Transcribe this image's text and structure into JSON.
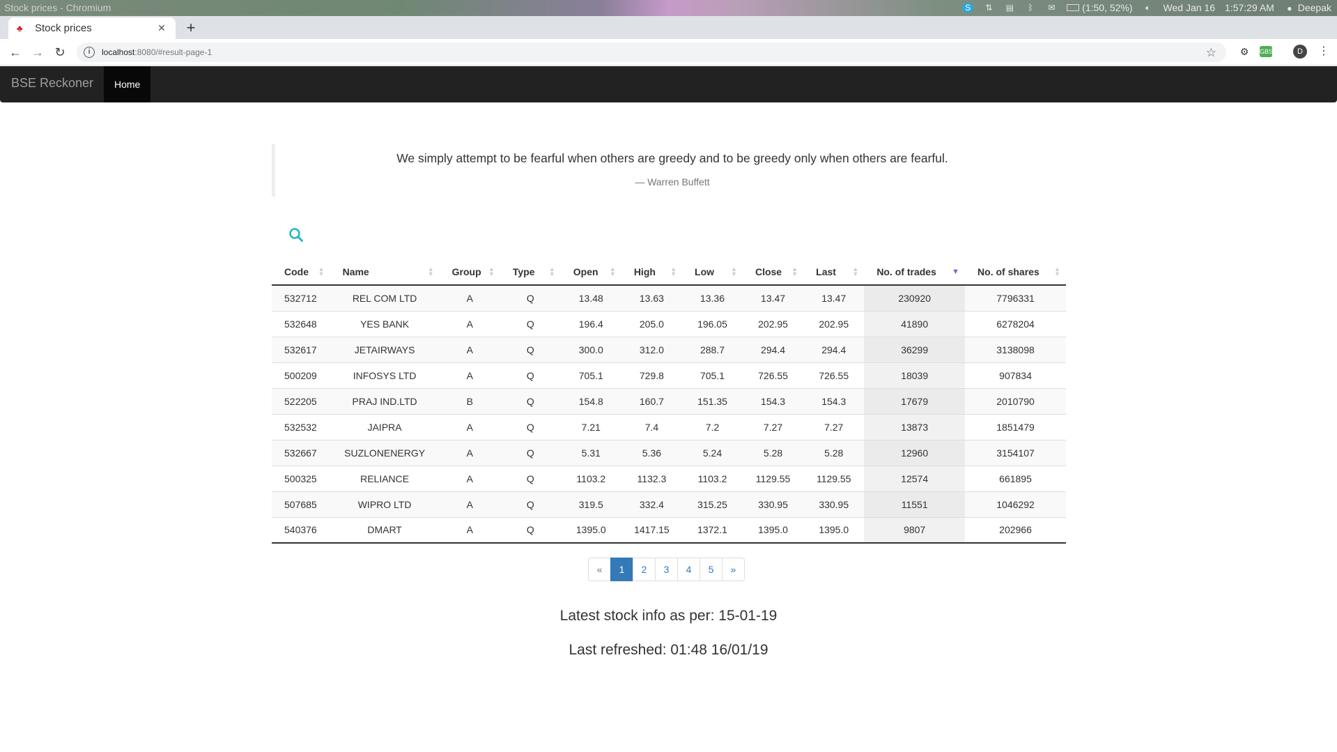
{
  "os": {
    "window_title": "Stock prices - Chromium",
    "battery": "(1:50, 52%)",
    "date": "Wed Jan 16",
    "time": "1:57:29 AM",
    "user": "Deepak"
  },
  "browser": {
    "tab_title": "Stock prices",
    "url_host": "localhost",
    "url_rest": ":8080/#result-page-1",
    "avatar_letter": "D",
    "ext_label": "GBS"
  },
  "navbar": {
    "brand": "BSE Reckoner",
    "home": "Home"
  },
  "quote": {
    "text": "We simply attempt to be fearful when others are greedy and to be greedy only when others are fearful.",
    "author": "— Warren Buffett"
  },
  "table": {
    "headers": [
      "Code",
      "Name",
      "Group",
      "Type",
      "Open",
      "High",
      "Low",
      "Close",
      "Last",
      "No. of trades",
      "No. of shares"
    ],
    "sorted_column": "No. of trades",
    "rows": [
      [
        "532712",
        "REL COM LTD",
        "A",
        "Q",
        "13.48",
        "13.63",
        "13.36",
        "13.47",
        "13.47",
        "230920",
        "7796331"
      ],
      [
        "532648",
        "YES BANK",
        "A",
        "Q",
        "196.4",
        "205.0",
        "196.05",
        "202.95",
        "202.95",
        "41890",
        "6278204"
      ],
      [
        "532617",
        "JETAIRWAYS",
        "A",
        "Q",
        "300.0",
        "312.0",
        "288.7",
        "294.4",
        "294.4",
        "36299",
        "3138098"
      ],
      [
        "500209",
        "INFOSYS LTD",
        "A",
        "Q",
        "705.1",
        "729.8",
        "705.1",
        "726.55",
        "726.55",
        "18039",
        "907834"
      ],
      [
        "522205",
        "PRAJ IND.LTD",
        "B",
        "Q",
        "154.8",
        "160.7",
        "151.35",
        "154.3",
        "154.3",
        "17679",
        "2010790"
      ],
      [
        "532532",
        "JAIPRA",
        "A",
        "Q",
        "7.21",
        "7.4",
        "7.2",
        "7.27",
        "7.27",
        "13873",
        "1851479"
      ],
      [
        "532667",
        "SUZLONENERGY",
        "A",
        "Q",
        "5.31",
        "5.36",
        "5.24",
        "5.28",
        "5.28",
        "12960",
        "3154107"
      ],
      [
        "500325",
        "RELIANCE",
        "A",
        "Q",
        "1103.2",
        "1132.3",
        "1103.2",
        "1129.55",
        "1129.55",
        "12574",
        "661895"
      ],
      [
        "507685",
        "WIPRO LTD",
        "A",
        "Q",
        "319.5",
        "332.4",
        "315.25",
        "330.95",
        "330.95",
        "11551",
        "1046292"
      ],
      [
        "540376",
        "DMART",
        "A",
        "Q",
        "1395.0",
        "1417.15",
        "1372.1",
        "1395.0",
        "1395.0",
        "9807",
        "202966"
      ]
    ]
  },
  "pagination": {
    "prev": "«",
    "pages": [
      "1",
      "2",
      "3",
      "4",
      "5"
    ],
    "next": "»",
    "active": "1"
  },
  "footer": {
    "latest": "Latest stock info as per: 15-01-19",
    "refreshed": "Last refreshed: 01:48 16/01/19"
  }
}
